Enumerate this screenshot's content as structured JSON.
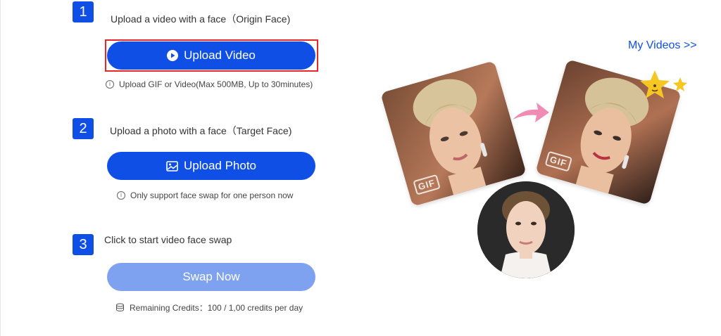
{
  "steps": [
    {
      "number": "1",
      "title": "Upload a video with a face（Origin Face)",
      "button": "Upload Video",
      "hint": "Upload GIF or Video(Max 500MB, Up to 30minutes)"
    },
    {
      "number": "2",
      "title": "Upload a photo with a face（Target Face)",
      "button": "Upload Photo",
      "hint": "Only support face swap for one person now"
    },
    {
      "number": "3",
      "title": "Click to start video face swap",
      "button": "Swap Now",
      "hint": "Remaining Credits：100 / 1,00 credits per day"
    }
  ],
  "my_videos": "My Videos >>",
  "illustration": {
    "origin_tag": "GIF",
    "result_tag": "GIF"
  },
  "colors": {
    "primary": "#0f4fe6",
    "disabled": "#7ea2f0",
    "highlight": "#e8262a",
    "arrow": "#f08cb4",
    "star": "#f6c623"
  }
}
